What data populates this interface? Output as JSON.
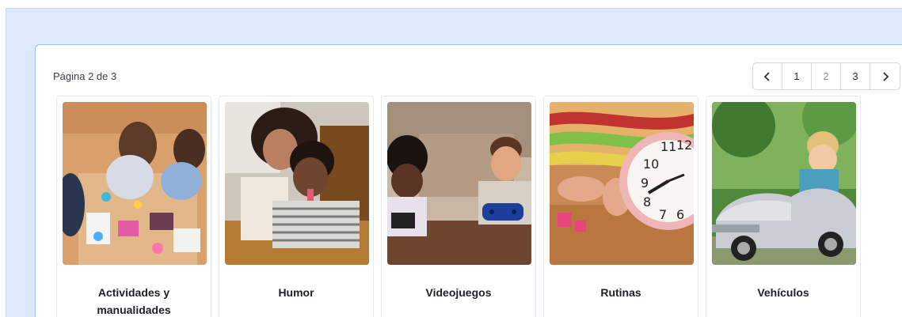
{
  "pagination": {
    "indicator": "Página 2 de 3",
    "prev_icon": "chevron-left-icon",
    "next_icon": "chevron-right-icon",
    "pages": [
      "1",
      "2",
      "3"
    ],
    "current_page": "2"
  },
  "categories": [
    {
      "title": "Actividades y manualidades",
      "image": "kids-crafts-photo"
    },
    {
      "title": "Humor",
      "image": "kids-funny-faces-photo"
    },
    {
      "title": "Videojuegos",
      "image": "kids-playing-videogames-photo"
    },
    {
      "title": "Rutinas",
      "image": "alarm-clock-photo"
    },
    {
      "title": "Vehículos",
      "image": "kid-toy-car-photo"
    }
  ]
}
